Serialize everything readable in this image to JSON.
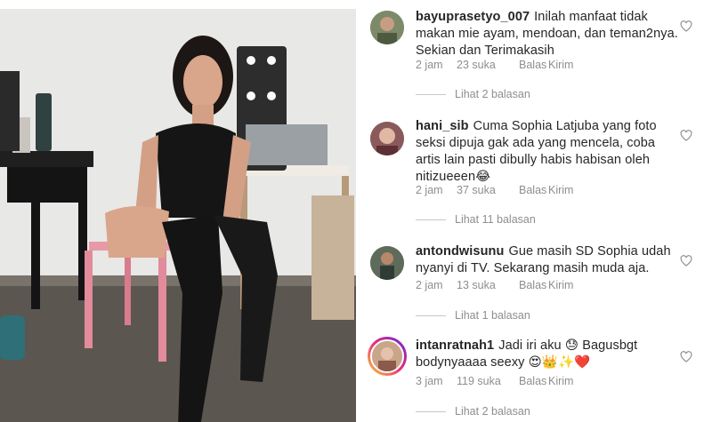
{
  "comments": [
    {
      "username": "bayuprasetyo_007",
      "text": "Inilah manfaat tidak makan mie ayam, mendoan, dan teman2nya. Sekian dan Terimakasih",
      "age": "2 jam",
      "likes": "23 suka",
      "reply_label": "Balas",
      "send_label": "Kirim",
      "replies_label": "Lihat 2 balasan",
      "avatar_color": "#7d8a6a"
    },
    {
      "username": "hani_sib",
      "text": "Cuma Sophia Latjuba yang foto seksi dipuja gak ada yang mencela, coba artis lain pasti dibully habis habisan oleh nitizueeen😂",
      "age": "2 jam",
      "likes": "37 suka",
      "reply_label": "Balas",
      "send_label": "Kirim",
      "replies_label": "Lihat 11 balasan",
      "avatar_color": "#8a5a5a"
    },
    {
      "username": "antondwisunu",
      "text": "Gue masih SD Sophia udah nyanyi di TV. Sekarang masih muda aja.",
      "age": "2 jam",
      "likes": "13 suka",
      "reply_label": "Balas",
      "send_label": "Kirim",
      "replies_label": "Lihat 1 balasan",
      "avatar_color": "#5f6b5a"
    },
    {
      "username": "intanratnah1",
      "text": "Jadi iri aku 😓 Bagusbgt bodynyaaaa seexy 😍👑✨❤️",
      "age": "3 jam",
      "likes": "119 suka",
      "reply_label": "Balas",
      "send_label": "Kirim",
      "replies_label": "Lihat 2 balasan",
      "avatar_color": "#c9a58a"
    }
  ],
  "icons": {
    "like": "heart-outline-icon"
  },
  "colors": {
    "username": "#262626",
    "meta": "#8e8e8e",
    "story_ring": [
      "#f9ce34",
      "#ee2a7b",
      "#6228d7"
    ]
  }
}
